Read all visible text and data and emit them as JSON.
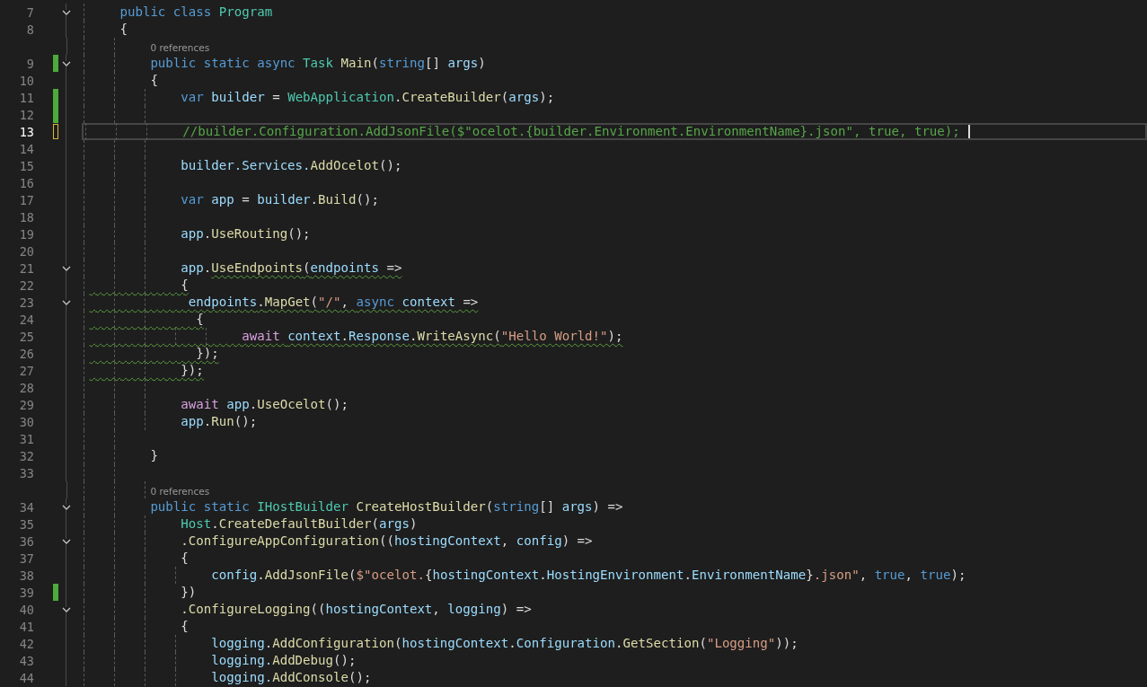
{
  "editor": {
    "lines": [
      {
        "number": "7",
        "saved_change": false,
        "unsaved_change": false,
        "foldable": true,
        "current": false,
        "tokens": [
          {
            "text": "    public class ",
            "kind": "keyword"
          },
          {
            "text": "Program",
            "kind": "type"
          }
        ]
      },
      {
        "number": "8",
        "saved_change": false,
        "unsaved_change": false,
        "foldable": false,
        "current": false,
        "tokens": [
          {
            "text": "    {",
            "kind": "plain"
          }
        ]
      },
      {
        "number": "9",
        "codelens": "0 references",
        "saved_change": true,
        "unsaved_change": false,
        "foldable": true,
        "current": false,
        "tokens": [
          {
            "text": "        public static async ",
            "kind": "keyword"
          },
          {
            "text": "Task ",
            "kind": "type"
          },
          {
            "text": "Main",
            "kind": "method"
          },
          {
            "text": "(",
            "kind": "plain"
          },
          {
            "text": "string",
            "kind": "keyword"
          },
          {
            "text": "[] ",
            "kind": "plain"
          },
          {
            "text": "args",
            "kind": "variable"
          },
          {
            "text": ")",
            "kind": "plain"
          }
        ]
      },
      {
        "number": "10",
        "saved_change": false,
        "unsaved_change": false,
        "foldable": false,
        "current": false,
        "tokens": [
          {
            "text": "        {",
            "kind": "plain"
          }
        ]
      },
      {
        "number": "11",
        "saved_change": true,
        "unsaved_change": false,
        "foldable": false,
        "current": false,
        "tokens": [
          {
            "text": "            var ",
            "kind": "keyword"
          },
          {
            "text": "builder",
            "kind": "variable"
          },
          {
            "text": " = ",
            "kind": "plain"
          },
          {
            "text": "WebApplication",
            "kind": "type"
          },
          {
            "text": ".",
            "kind": "plain"
          },
          {
            "text": "CreateBuilder",
            "kind": "method"
          },
          {
            "text": "(",
            "kind": "plain"
          },
          {
            "text": "args",
            "kind": "variable"
          },
          {
            "text": ");",
            "kind": "plain"
          }
        ]
      },
      {
        "number": "12",
        "saved_change": true,
        "unsaved_change": false,
        "foldable": false,
        "current": false
      },
      {
        "number": "13",
        "saved_change": false,
        "unsaved_change": true,
        "foldable": false,
        "current": true,
        "tokens": [
          {
            "text": "            //builder.Configuration.AddJsonFile($\"ocelot.{builder.Environment.EnvironmentName}.json\", true, true);",
            "kind": "comment"
          }
        ]
      },
      {
        "number": "14",
        "saved_change": false,
        "unsaved_change": false,
        "foldable": false,
        "current": false
      },
      {
        "number": "15",
        "saved_change": false,
        "unsaved_change": false,
        "foldable": false,
        "current": false,
        "tokens": [
          {
            "text": "            builder.Services.",
            "kind": "variable"
          },
          {
            "text": "AddOcelot",
            "kind": "method"
          },
          {
            "text": "();",
            "kind": "plain"
          }
        ]
      },
      {
        "number": "16",
        "saved_change": false,
        "unsaved_change": false,
        "foldable": false,
        "current": false
      },
      {
        "number": "17",
        "saved_change": false,
        "unsaved_change": false,
        "foldable": false,
        "current": false,
        "tokens": [
          {
            "text": "            var ",
            "kind": "keyword"
          },
          {
            "text": "app",
            "kind": "variable"
          },
          {
            "text": " = ",
            "kind": "plain"
          },
          {
            "text": "builder",
            "kind": "variable"
          },
          {
            "text": ".",
            "kind": "plain"
          },
          {
            "text": "Build",
            "kind": "method"
          },
          {
            "text": "();",
            "kind": "plain"
          }
        ]
      },
      {
        "number": "18",
        "saved_change": false,
        "unsaved_change": false,
        "foldable": false,
        "current": false
      },
      {
        "number": "19",
        "saved_change": false,
        "unsaved_change": false,
        "foldable": false,
        "current": false,
        "tokens": [
          {
            "text": "            app",
            "kind": "variable"
          },
          {
            "text": ".",
            "kind": "plain"
          },
          {
            "text": "UseRouting",
            "kind": "method"
          },
          {
            "text": "();",
            "kind": "plain"
          }
        ]
      },
      {
        "number": "20",
        "saved_change": false,
        "unsaved_change": false,
        "foldable": false,
        "current": false
      },
      {
        "number": "21",
        "saved_change": false,
        "unsaved_change": false,
        "foldable": true,
        "current": false,
        "tokens": [
          {
            "text": "            app",
            "kind": "variable",
            "warn": false
          },
          {
            "text": ".",
            "kind": "plain",
            "warn": false
          },
          {
            "text": "UseEndpoints",
            "kind": "method",
            "warn": true
          },
          {
            "text": "(",
            "kind": "plain",
            "warn": true
          },
          {
            "text": "endpoints",
            "kind": "variable",
            "warn": true
          },
          {
            "text": " =>",
            "kind": "plain",
            "warn": true
          }
        ]
      },
      {
        "number": "22",
        "saved_change": false,
        "unsaved_change": false,
        "foldable": false,
        "current": false,
        "tokens": [
          {
            "text": "            {",
            "kind": "plain",
            "warn": true
          }
        ]
      },
      {
        "number": "23",
        "saved_change": false,
        "unsaved_change": false,
        "foldable": true,
        "current": false,
        "tokens": [
          {
            "text": "             endpoints",
            "kind": "variable",
            "warn": true
          },
          {
            "text": ".",
            "kind": "plain",
            "warn": true
          },
          {
            "text": "MapGet",
            "kind": "method",
            "warn": true
          },
          {
            "text": "(",
            "kind": "plain",
            "warn": true
          },
          {
            "text": "\"/\"",
            "kind": "string",
            "warn": true
          },
          {
            "text": ", ",
            "kind": "plain",
            "warn": true
          },
          {
            "text": "async ",
            "kind": "keyword",
            "warn": true
          },
          {
            "text": "context",
            "kind": "variable",
            "warn": true
          },
          {
            "text": " =>",
            "kind": "plain",
            "warn": true
          }
        ]
      },
      {
        "number": "24",
        "saved_change": false,
        "unsaved_change": false,
        "foldable": false,
        "current": false,
        "tokens": [
          {
            "text": "              {",
            "kind": "plain",
            "warn": true
          }
        ]
      },
      {
        "number": "25",
        "saved_change": false,
        "unsaved_change": false,
        "foldable": false,
        "current": false,
        "tokens": [
          {
            "text": "                    await ",
            "kind": "control",
            "warn": true
          },
          {
            "text": "context",
            "kind": "variable",
            "warn": true
          },
          {
            "text": ".",
            "kind": "plain",
            "warn": true
          },
          {
            "text": "Response",
            "kind": "variable",
            "warn": true
          },
          {
            "text": ".",
            "kind": "plain",
            "warn": true
          },
          {
            "text": "WriteAsync",
            "kind": "method",
            "warn": true
          },
          {
            "text": "(",
            "kind": "plain",
            "warn": true
          },
          {
            "text": "\"Hello World!\"",
            "kind": "string",
            "warn": true
          },
          {
            "text": ");",
            "kind": "plain",
            "warn": true
          }
        ]
      },
      {
        "number": "26",
        "saved_change": false,
        "unsaved_change": false,
        "foldable": false,
        "current": false,
        "tokens": [
          {
            "text": "              });",
            "kind": "plain",
            "warn": true
          }
        ]
      },
      {
        "number": "27",
        "saved_change": false,
        "unsaved_change": false,
        "foldable": false,
        "current": false,
        "tokens": [
          {
            "text": "            });",
            "kind": "plain",
            "warn": true
          }
        ]
      },
      {
        "number": "28",
        "saved_change": false,
        "unsaved_change": false,
        "foldable": false,
        "current": false
      },
      {
        "number": "29",
        "saved_change": false,
        "unsaved_change": false,
        "foldable": false,
        "current": false,
        "tokens": [
          {
            "text": "            await ",
            "kind": "control"
          },
          {
            "text": "app",
            "kind": "variable"
          },
          {
            "text": ".",
            "kind": "plain"
          },
          {
            "text": "UseOcelot",
            "kind": "method"
          },
          {
            "text": "();",
            "kind": "plain"
          }
        ]
      },
      {
        "number": "30",
        "saved_change": false,
        "unsaved_change": false,
        "foldable": false,
        "current": false,
        "tokens": [
          {
            "text": "            app",
            "kind": "variable"
          },
          {
            "text": ".",
            "kind": "plain"
          },
          {
            "text": "Run",
            "kind": "method"
          },
          {
            "text": "();",
            "kind": "plain"
          }
        ]
      },
      {
        "number": "31",
        "saved_change": false,
        "unsaved_change": false,
        "foldable": false,
        "current": false
      },
      {
        "number": "32",
        "saved_change": false,
        "unsaved_change": false,
        "foldable": false,
        "current": false,
        "tokens": [
          {
            "text": "        }",
            "kind": "plain"
          }
        ]
      },
      {
        "number": "33",
        "saved_change": false,
        "unsaved_change": false,
        "foldable": false,
        "current": false
      },
      {
        "number": "34",
        "codelens": "0 references",
        "saved_change": false,
        "unsaved_change": false,
        "foldable": true,
        "current": false,
        "tokens": [
          {
            "text": "        public static ",
            "kind": "keyword"
          },
          {
            "text": "IHostBuilder ",
            "kind": "type"
          },
          {
            "text": "CreateHostBuilder",
            "kind": "method"
          },
          {
            "text": "(",
            "kind": "plain"
          },
          {
            "text": "string",
            "kind": "keyword"
          },
          {
            "text": "[] ",
            "kind": "plain"
          },
          {
            "text": "args",
            "kind": "variable"
          },
          {
            "text": ") =>",
            "kind": "plain"
          }
        ]
      },
      {
        "number": "35",
        "saved_change": false,
        "unsaved_change": false,
        "foldable": false,
        "current": false,
        "tokens": [
          {
            "text": "            Host",
            "kind": "type"
          },
          {
            "text": ".",
            "kind": "plain"
          },
          {
            "text": "CreateDefaultBuilder",
            "kind": "method"
          },
          {
            "text": "(",
            "kind": "plain"
          },
          {
            "text": "args",
            "kind": "variable"
          },
          {
            "text": ")",
            "kind": "plain"
          }
        ]
      },
      {
        "number": "36",
        "saved_change": false,
        "unsaved_change": false,
        "foldable": true,
        "current": false,
        "tokens": [
          {
            "text": "            .ConfigureAppConfiguration",
            "kind": "method"
          },
          {
            "text": "((",
            "kind": "plain"
          },
          {
            "text": "hostingContext",
            "kind": "variable"
          },
          {
            "text": ", ",
            "kind": "plain"
          },
          {
            "text": "config",
            "kind": "variable"
          },
          {
            "text": ") =>",
            "kind": "plain"
          }
        ]
      },
      {
        "number": "37",
        "saved_change": false,
        "unsaved_change": false,
        "foldable": false,
        "current": false,
        "tokens": [
          {
            "text": "            {",
            "kind": "plain"
          }
        ]
      },
      {
        "number": "38",
        "saved_change": false,
        "unsaved_change": false,
        "foldable": false,
        "current": false,
        "tokens": [
          {
            "text": "                config",
            "kind": "variable"
          },
          {
            "text": ".",
            "kind": "plain"
          },
          {
            "text": "AddJsonFile",
            "kind": "method"
          },
          {
            "text": "(",
            "kind": "plain"
          },
          {
            "text": "$\"ocelot.",
            "kind": "string"
          },
          {
            "text": "{",
            "kind": "plain"
          },
          {
            "text": "hostingContext",
            "kind": "variable"
          },
          {
            "text": ".",
            "kind": "plain"
          },
          {
            "text": "HostingEnvironment",
            "kind": "variable"
          },
          {
            "text": ".",
            "kind": "plain"
          },
          {
            "text": "EnvironmentName",
            "kind": "variable"
          },
          {
            "text": "}",
            "kind": "plain"
          },
          {
            "text": ".json\"",
            "kind": "string"
          },
          {
            "text": ", ",
            "kind": "plain"
          },
          {
            "text": "true",
            "kind": "keyword"
          },
          {
            "text": ", ",
            "kind": "plain"
          },
          {
            "text": "true",
            "kind": "keyword"
          },
          {
            "text": ");",
            "kind": "plain"
          }
        ]
      },
      {
        "number": "39",
        "saved_change": true,
        "unsaved_change": false,
        "foldable": false,
        "current": false,
        "tokens": [
          {
            "text": "            })",
            "kind": "plain"
          }
        ]
      },
      {
        "number": "40",
        "saved_change": false,
        "unsaved_change": false,
        "foldable": true,
        "current": false,
        "tokens": [
          {
            "text": "            .ConfigureLogging",
            "kind": "method"
          },
          {
            "text": "((",
            "kind": "plain"
          },
          {
            "text": "hostingContext",
            "kind": "variable"
          },
          {
            "text": ", ",
            "kind": "plain"
          },
          {
            "text": "logging",
            "kind": "variable"
          },
          {
            "text": ") =>",
            "kind": "plain"
          }
        ]
      },
      {
        "number": "41",
        "saved_change": false,
        "unsaved_change": false,
        "foldable": false,
        "current": false,
        "tokens": [
          {
            "text": "            {",
            "kind": "plain"
          }
        ]
      },
      {
        "number": "42",
        "saved_change": false,
        "unsaved_change": false,
        "foldable": false,
        "current": false,
        "tokens": [
          {
            "text": "                logging",
            "kind": "variable"
          },
          {
            "text": ".",
            "kind": "plain"
          },
          {
            "text": "AddConfiguration",
            "kind": "method"
          },
          {
            "text": "(",
            "kind": "plain"
          },
          {
            "text": "hostingContext",
            "kind": "variable"
          },
          {
            "text": ".",
            "kind": "plain"
          },
          {
            "text": "Configuration",
            "kind": "variable"
          },
          {
            "text": ".",
            "kind": "plain"
          },
          {
            "text": "GetSection",
            "kind": "method"
          },
          {
            "text": "(",
            "kind": "plain"
          },
          {
            "text": "\"Logging\"",
            "kind": "string"
          },
          {
            "text": "));",
            "kind": "plain"
          }
        ]
      },
      {
        "number": "43",
        "saved_change": false,
        "unsaved_change": false,
        "foldable": false,
        "current": false,
        "tokens": [
          {
            "text": "                logging.",
            "kind": "variable"
          },
          {
            "text": "AddDebug",
            "kind": "method"
          },
          {
            "text": "();",
            "kind": "plain"
          }
        ]
      },
      {
        "number": "44",
        "saved_change": false,
        "unsaved_change": false,
        "foldable": false,
        "current": false,
        "tokens": [
          {
            "text": "                logging.",
            "kind": "variable"
          },
          {
            "text": "AddConsole",
            "kind": "method"
          },
          {
            "text": "();",
            "kind": "plain"
          }
        ]
      }
    ]
  }
}
